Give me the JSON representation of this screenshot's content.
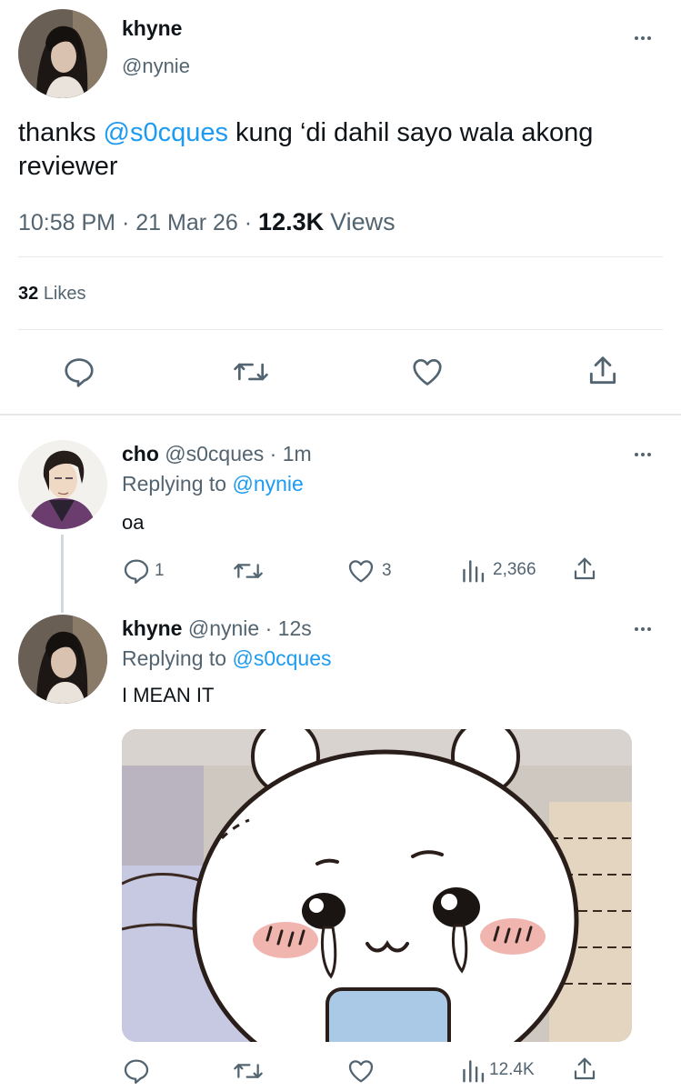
{
  "main_tweet": {
    "display_name": "khyne",
    "handle": "@nynie",
    "text_before": "thanks ",
    "mention": "@s0cques",
    "text_after": " kung ‘di dahil sayo wala akong reviewer",
    "time": "10:58 PM",
    "date": "21 Mar 26",
    "views_count": "12.3K",
    "views_label": "Views",
    "likes_count": "32",
    "likes_label": "Likes"
  },
  "reply1": {
    "display_name": "cho",
    "handle": "@s0cques",
    "time": "1m",
    "replying_prefix": "Replying to",
    "replying_handle": "@nynie",
    "text": "oa",
    "replies": "1",
    "likes": "3",
    "views": "2,366"
  },
  "reply2": {
    "display_name": "khyne",
    "handle": "@nynie",
    "time": "12s",
    "replying_prefix": "Replying to",
    "replying_handle": "@s0cques",
    "text": "I MEAN IT",
    "views": "12.4K"
  },
  "colors": {
    "link": "#1d9bf0",
    "muted": "#536471",
    "divider": "#e6e9ec"
  },
  "icons": [
    "reply-icon",
    "retweet-icon",
    "like-icon",
    "share-icon",
    "views-icon",
    "more-icon"
  ]
}
